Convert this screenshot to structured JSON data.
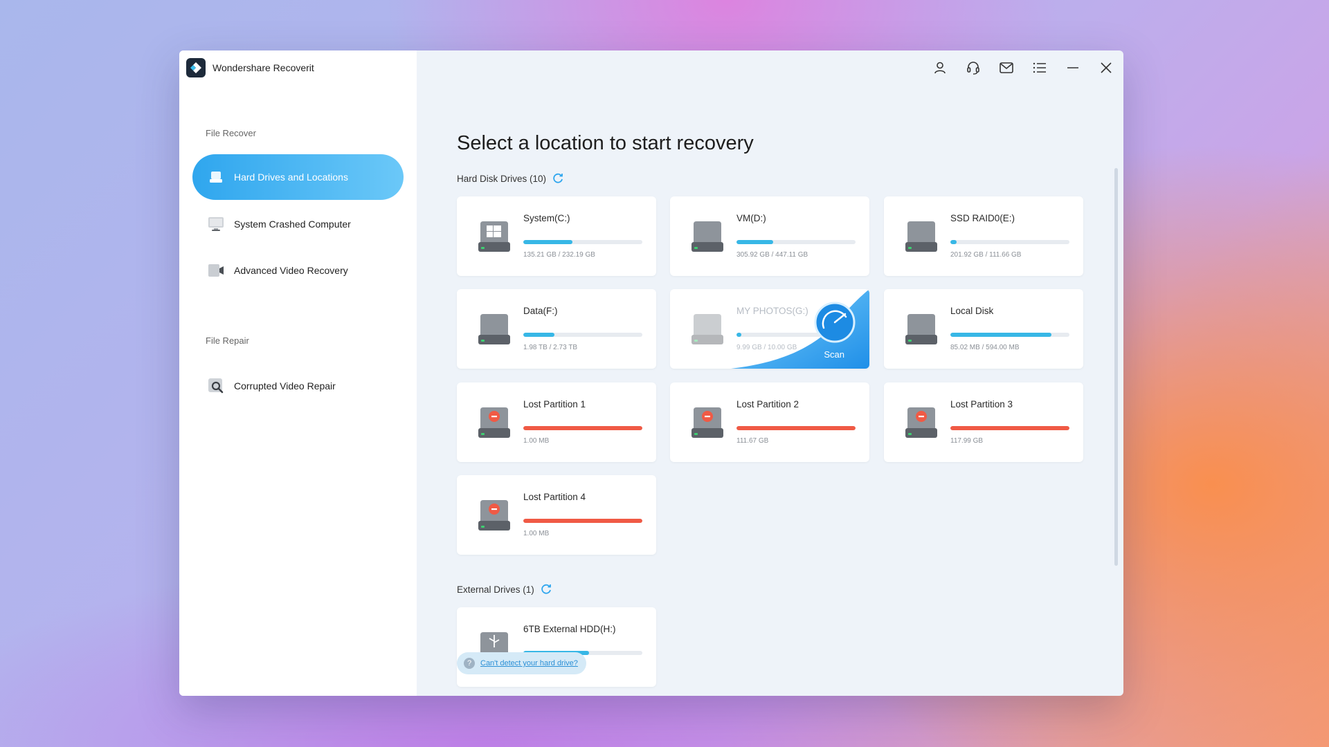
{
  "app": {
    "title": "Wondershare Recoverit"
  },
  "sidebar": {
    "sections": [
      {
        "label": "File Recover"
      },
      {
        "label": "File Repair"
      }
    ],
    "items": [
      {
        "label": "Hard Drives and Locations",
        "icon": "hard-drive-icon",
        "active": true
      },
      {
        "label": "System Crashed Computer",
        "icon": "monitor-icon"
      },
      {
        "label": "Advanced Video Recovery",
        "icon": "video-camera-icon"
      },
      {
        "label": "Corrupted Video Repair",
        "icon": "video-repair-icon"
      }
    ]
  },
  "titlebar": {
    "icons": [
      "user-icon",
      "headset-icon",
      "mail-icon",
      "menu-icon",
      "minimize-icon",
      "close-icon"
    ]
  },
  "main": {
    "title": "Select a location to start recovery",
    "hard_disk_label": "Hard Disk Drives (10)",
    "external_label": "External Drives (1)",
    "scan_label": "Scan",
    "help_text": "Can't detect your hard drive?"
  },
  "drives": [
    {
      "name": "System(C:)",
      "size": "135.21 GB / 232.19 GB",
      "usage": 0.41,
      "type": "windows"
    },
    {
      "name": "VM(D:)",
      "size": "305.92 GB / 447.11 GB",
      "usage": 0.31,
      "type": "normal"
    },
    {
      "name": "SSD RAID0(E:)",
      "size": "201.92 GB / 111.66 GB",
      "usage": 0.05,
      "type": "normal"
    },
    {
      "name": "Data(F:)",
      "size": "1.98 TB / 2.73 TB",
      "usage": 0.26,
      "type": "normal"
    },
    {
      "name": "MY PHOTOS(G:)",
      "size": "9.99 GB / 10.00 GB",
      "usage": 0.04,
      "type": "normal",
      "hover": true
    },
    {
      "name": "Local Disk",
      "size": "85.02 MB / 594.00 MB",
      "usage": 0.85,
      "type": "normal"
    },
    {
      "name": "Lost Partition 1",
      "size": "1.00 MB",
      "usage": 1.0,
      "type": "lost"
    },
    {
      "name": "Lost Partition 2",
      "size": "111.67 GB",
      "usage": 1.0,
      "type": "lost"
    },
    {
      "name": "Lost Partition 3",
      "size": "117.99 GB",
      "usage": 1.0,
      "type": "lost"
    },
    {
      "name": "Lost Partition 4",
      "size": "1.00 MB",
      "usage": 1.0,
      "type": "lost"
    }
  ],
  "external_drives": [
    {
      "name": "6TB External HDD(H:)",
      "usage": 0.55,
      "type": "usb"
    }
  ],
  "colors": {
    "accent": "#37b7e6",
    "lost": "#f05a45",
    "active_nav": "#2fa6ee"
  }
}
